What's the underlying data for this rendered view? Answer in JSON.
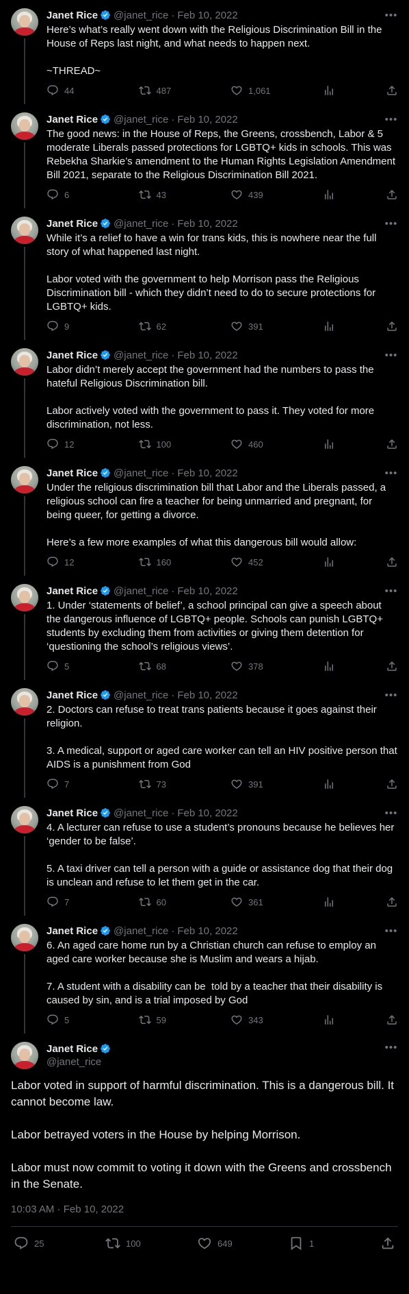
{
  "author": {
    "name": "Janet Rice",
    "handle": "@janet_rice",
    "date": "Feb 10, 2022",
    "dot": "·"
  },
  "thread": [
    {
      "text": "Here’s what’s really went down with the Religious Discrimination Bill in the House of Reps last night, and what needs to happen next.\n\n~THREAD~",
      "replies": "44",
      "retweets": "487",
      "likes": "1,061"
    },
    {
      "text": "The good news: in the House of Reps, the Greens, crossbench, Labor & 5 moderate Liberals passed protections for LGBTQ+ kids in schools. This was Rebekha Sharkie’s amendment to the Human Rights Legislation Amendment Bill 2021, separate to the Religious Discrimination Bill 2021.",
      "replies": "6",
      "retweets": "43",
      "likes": "439"
    },
    {
      "text": "While it’s a relief to have a win for trans kids, this is nowhere near the full story of what happened last night.\n\nLabor voted with the government to help Morrison pass the Religious Discrimination bill - which they didn’t need to do to secure protections for LGBTQ+ kids.",
      "replies": "9",
      "retweets": "62",
      "likes": "391"
    },
    {
      "text": "Labor didn’t merely accept the government had the numbers to pass the hateful Religious Discrimination bill.\n\nLabor actively voted with the government to pass it. They voted for more discrimination, not less.",
      "replies": "12",
      "retweets": "100",
      "likes": "460"
    },
    {
      "text": "Under the religious discrimination bill that Labor and the Liberals passed, a religious school can fire a teacher for being unmarried and pregnant, for being queer, for getting a divorce.\n\nHere’s a few more examples of what this dangerous bill would allow:",
      "replies": "12",
      "retweets": "160",
      "likes": "452"
    },
    {
      "text": "1. Under ‘statements of belief’, a school principal can give a speech about the dangerous influence of LGBTQ+ people. Schools can punish LGBTQ+ students by excluding them from activities or giving them detention for ‘questioning the school’s religious views’.",
      "replies": "5",
      "retweets": "68",
      "likes": "378"
    },
    {
      "text": "2. Doctors can refuse to treat trans patients because it goes against their religion.\n\n3. A medical, support or aged care worker can tell an HIV positive person that AIDS is a punishment from God",
      "replies": "7",
      "retweets": "73",
      "likes": "391"
    },
    {
      "text": "4. A lecturer can refuse to use a student’s pronouns because he believes her ‘gender to be false’.\n\n5. A taxi driver can tell a person with a guide or assistance dog that their dog is unclean and refuse to let them get in the car.",
      "replies": "7",
      "retweets": "60",
      "likes": "361"
    },
    {
      "text": "6. An aged care home run by a Christian church can refuse to employ an aged care worker because she is Muslim and wears a hijab.\n\n7. A student with a disability can be  told by a teacher that their disability is caused by sin, and is a trial imposed by God",
      "replies": "5",
      "retweets": "59",
      "likes": "343"
    }
  ],
  "main": {
    "text": "Labor voted in support of harmful discrimination. This is a dangerous bill. It cannot become law.\n\nLabor betrayed voters in the House by helping Morrison.\n\nLabor must now commit to voting it down with the Greens and crossbench in the Senate.",
    "timestamp": "10:03 AM · Feb 10, 2022",
    "replies": "25",
    "retweets": "100",
    "likes": "649",
    "bookmarks": "1"
  },
  "icons": {
    "more": "more-icon",
    "verified": "verified-badge-icon",
    "reply": "reply-icon",
    "retweet": "retweet-icon",
    "like": "like-icon",
    "views": "views-icon",
    "share": "share-icon",
    "bookmark": "bookmark-icon"
  },
  "colors": {
    "background": "#000000",
    "text": "#e7e9ea",
    "muted": "#71767b",
    "verified": "#1d9bf0",
    "line": "#333639"
  }
}
